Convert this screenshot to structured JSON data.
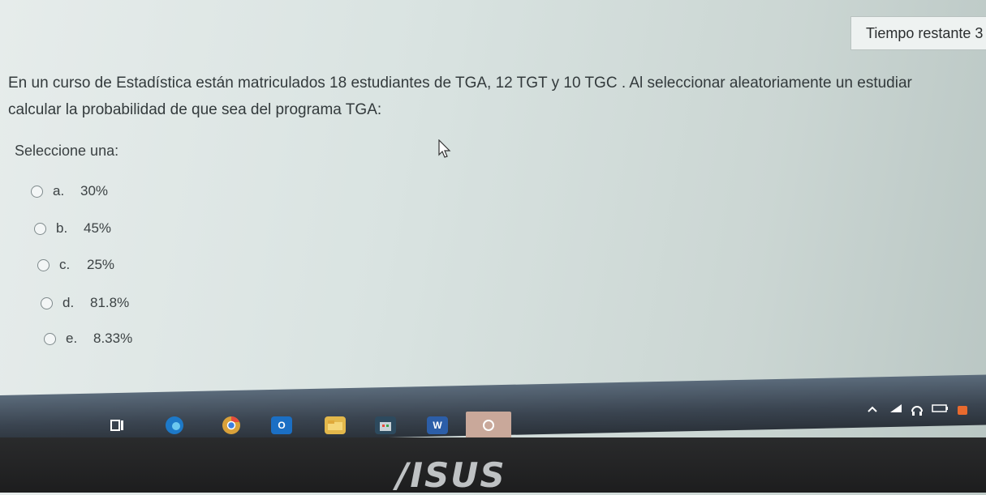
{
  "timer": {
    "label": "Tiempo restante 3"
  },
  "question": {
    "line1": "En un curso de Estadística están matriculados 18 estudiantes de TGA,  12 TGT y 10 TGC . Al seleccionar aleatoriamente   un estudiar",
    "line2": "calcular la probabilidad de que sea del programa TGA:"
  },
  "prompt": "Seleccione una:",
  "options": [
    {
      "letter": "a.",
      "value": "30%"
    },
    {
      "letter": "b.",
      "value": "45%"
    },
    {
      "letter": "c.",
      "value": "25%"
    },
    {
      "letter": "d.",
      "value": "81.8%"
    },
    {
      "letter": "e.",
      "value": "8.33%"
    }
  ],
  "taskbar": {
    "icons": [
      "task-view-icon",
      "edge-icon",
      "chrome-icon",
      "outlook-icon",
      "file-explorer-icon",
      "store-icon",
      "word-icon",
      "camera-icon"
    ],
    "word_glyph": "W",
    "outlook_glyph": "O"
  },
  "bezel": {
    "logo": "/ISUS"
  }
}
